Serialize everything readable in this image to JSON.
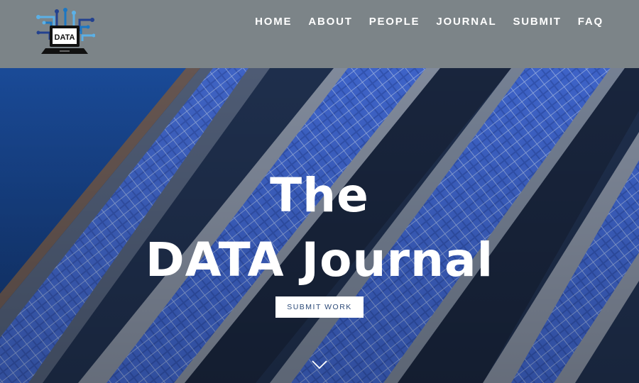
{
  "logo": {
    "text": "DATA",
    "icon": "data-laptop-logo-icon"
  },
  "nav": {
    "items": [
      {
        "label": "HOME"
      },
      {
        "label": "ABOUT"
      },
      {
        "label": "PEOPLE"
      },
      {
        "label": "JOURNAL"
      },
      {
        "label": "SUBMIT"
      },
      {
        "label": "FAQ"
      }
    ]
  },
  "hero": {
    "title_line1": "The",
    "title_line2": "DATA Journal",
    "cta_label": "SUBMIT WORK",
    "scroll_icon": "chevron-down-icon"
  },
  "colors": {
    "header_bg": "#7c8488",
    "sky": "#1f4fa0",
    "panel": "#3d63c6",
    "button_text": "#2c4a78"
  }
}
